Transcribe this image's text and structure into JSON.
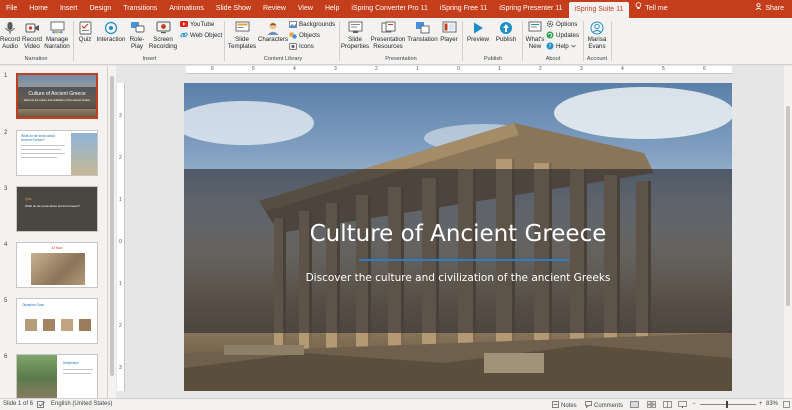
{
  "tabs": [
    "File",
    "Home",
    "Insert",
    "Design",
    "Transitions",
    "Animations",
    "Slide Show",
    "Review",
    "View",
    "Help",
    "iSpring Converter Pro 11",
    "iSpring Free 11",
    "iSpring Presenter 11",
    "iSpring Suite 11"
  ],
  "active_tab": "iSpring Suite 11",
  "tell_me": "Tell me",
  "share": "Share",
  "ribbon": {
    "narration": {
      "label": "Narration",
      "record_audio": "Record Audio",
      "record_video": "Record Video",
      "manage_narration": "Manage Narration"
    },
    "insert": {
      "label": "Insert",
      "quiz": "Quiz",
      "interaction": "Interaction",
      "role_play": "Role-Play",
      "screen_recording": "Screen Recording",
      "youtube": "YouTube",
      "web_object": "Web Object"
    },
    "content_library": {
      "label": "Content Library",
      "slide_templates": "Slide Templates",
      "characters": "Characters",
      "backgrounds": "Backgrounds",
      "objects": "Objects",
      "icons": "Icons"
    },
    "presentation": {
      "label": "Presentation",
      "slide_properties": "Slide Properties",
      "presentation_resources": "Presentation Resources",
      "translation": "Translation",
      "player": "Player"
    },
    "publish": {
      "label": "Publish",
      "preview": "Preview",
      "publish": "Publish"
    },
    "about": {
      "label": "About",
      "whats_new": "What's New",
      "options": "Options",
      "updates": "Updates",
      "help": "Help"
    },
    "account": {
      "label": "Account",
      "user": "Marisa Evans"
    }
  },
  "thumbnails": [
    {
      "num": "1",
      "title": "Culture of Ancient Greece",
      "sub": "Discover the culture and civilization of the ancient Greeks"
    },
    {
      "num": "2",
      "title": "What do we know about Ancient Greece?"
    },
    {
      "num": "3",
      "title": "Quiz",
      "sub": "What do we know about ancient Greece?"
    },
    {
      "num": "4",
      "title": "42 Now"
    },
    {
      "num": "5",
      "title": "Olympian Gods"
    },
    {
      "num": "6",
      "title": "Delphinium"
    }
  ],
  "ruler_h": [
    "6",
    "5",
    "4",
    "3",
    "2",
    "1",
    "0",
    "1",
    "2",
    "3",
    "4",
    "5",
    "6"
  ],
  "ruler_v": [
    "3",
    "2",
    "1",
    "0",
    "1",
    "2",
    "3"
  ],
  "slide": {
    "title": "Culture of Ancient Greece",
    "subtitle": "Discover the culture and civilization of the ancient Greeks",
    "accent": "#2a7ec8"
  },
  "status": {
    "slide_info": "Slide 1 of 6",
    "language": "English (United States)",
    "notes": "Notes",
    "comments": "Comments",
    "zoom": "83%"
  },
  "colors": {
    "brand": "#c43e1c",
    "ribbon_bg": "#f3f2f1"
  }
}
